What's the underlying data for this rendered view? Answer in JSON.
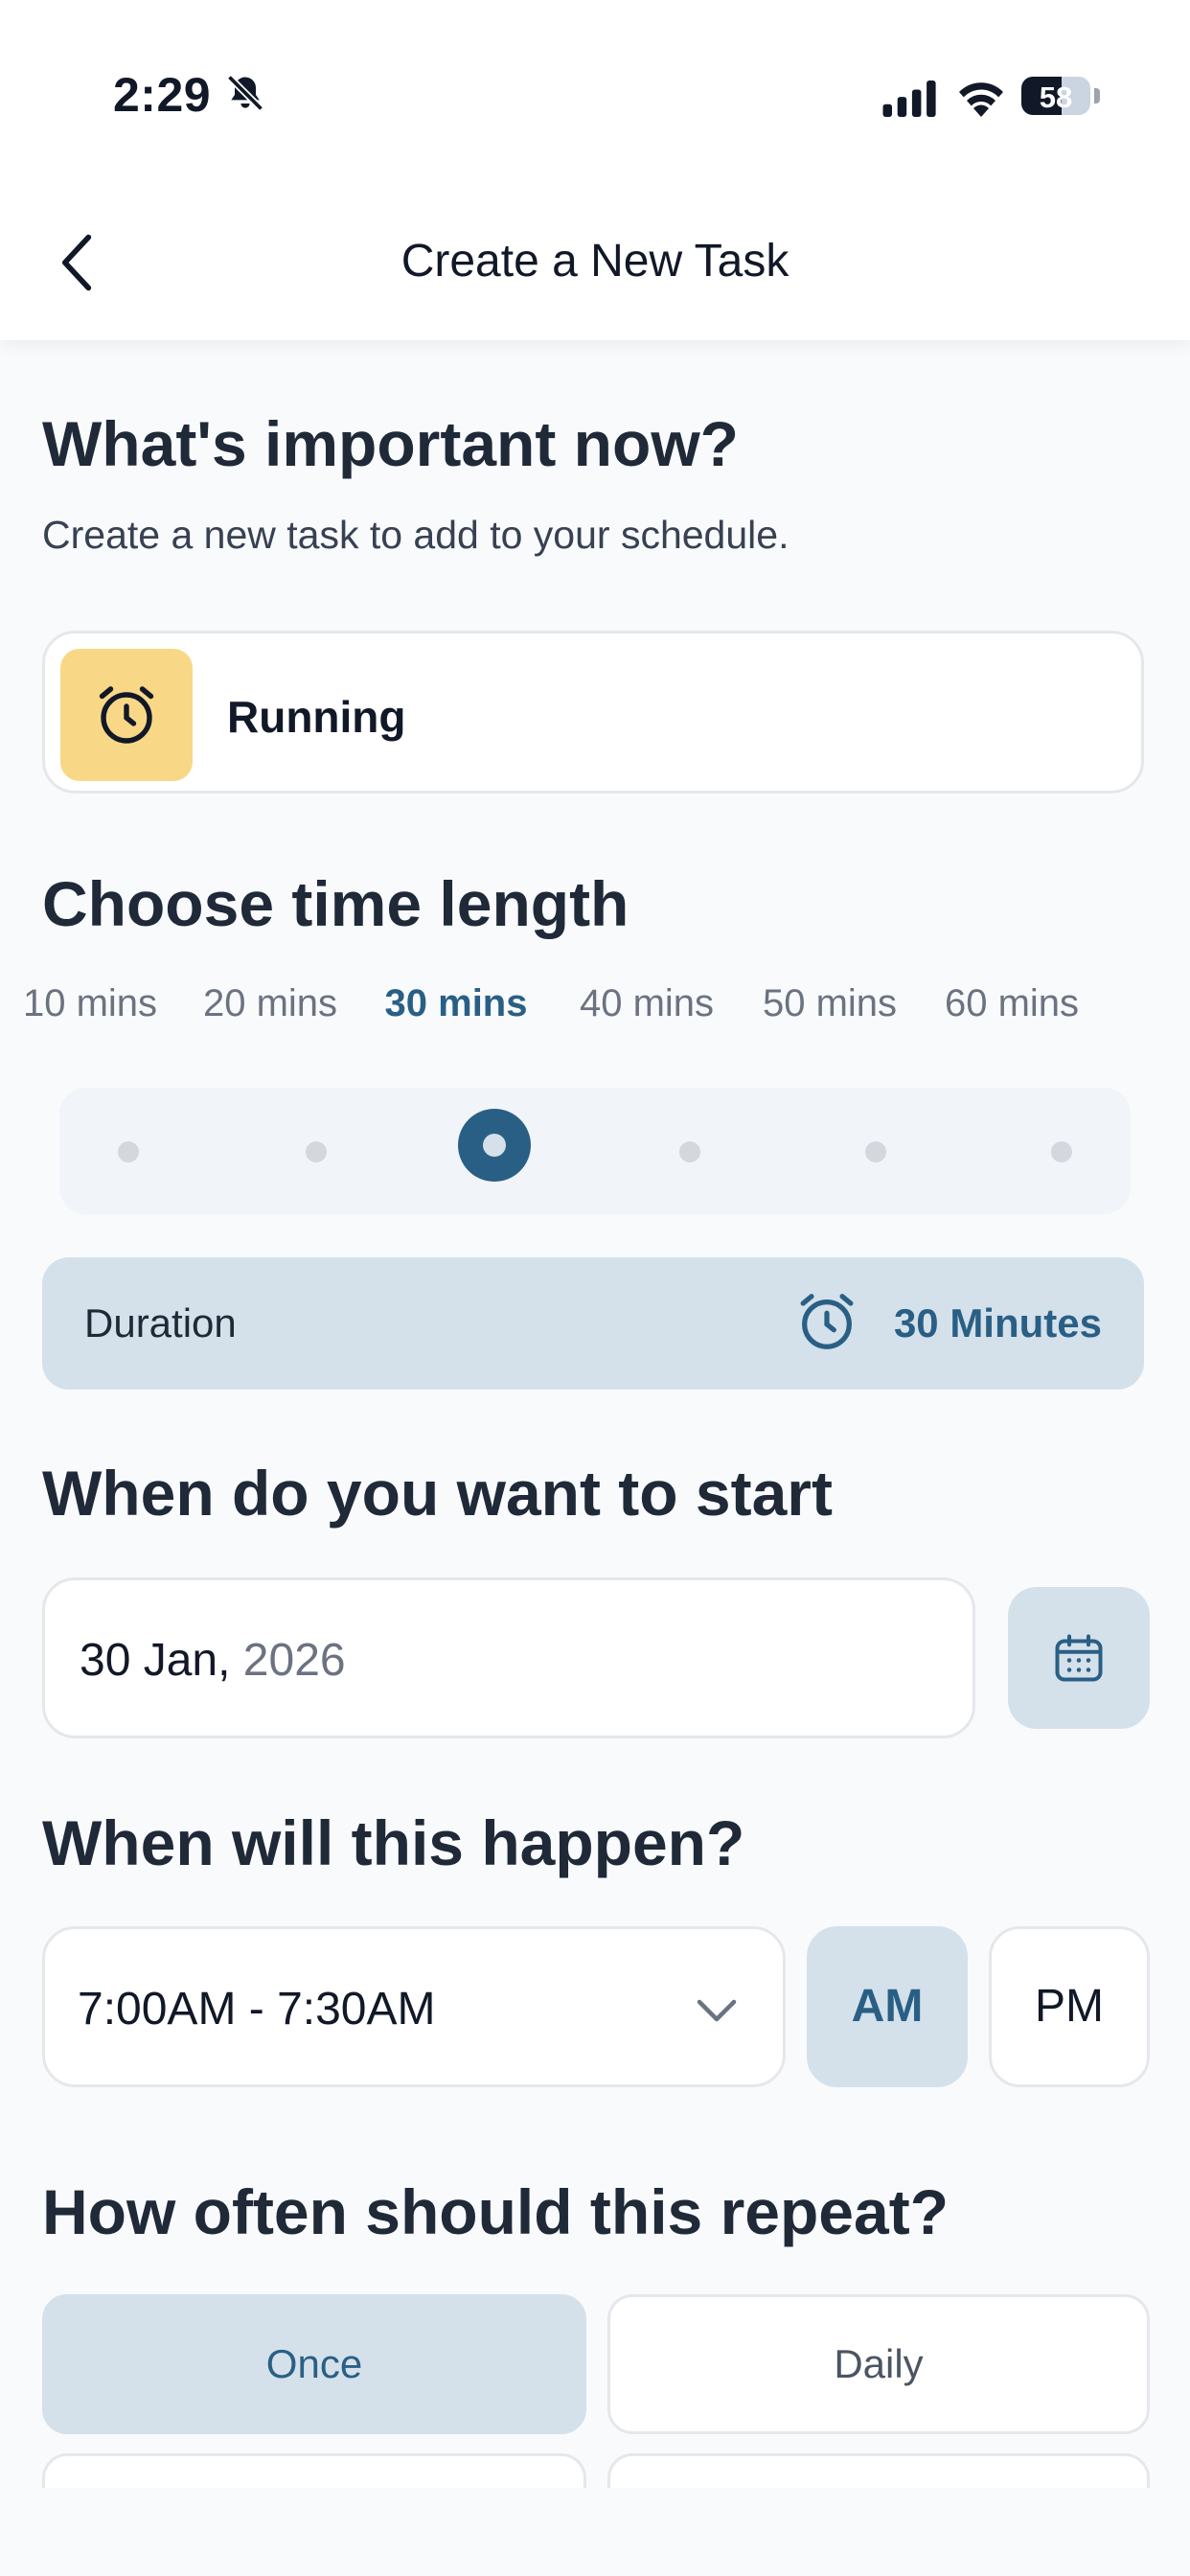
{
  "status_bar": {
    "time": "2:29",
    "battery": "58",
    "battery_level": 0.58
  },
  "header": {
    "title": "Create a New Task"
  },
  "intro": {
    "heading": "What's important now?",
    "subtitle": "Create a new task to add to your schedule."
  },
  "task": {
    "name": "Running",
    "icon": "alarm-clock-icon",
    "icon_bg": "#f8d887"
  },
  "time_length": {
    "heading": "Choose time length",
    "options": [
      "10 mins",
      "20 mins",
      "30 mins",
      "40 mins",
      "50 mins",
      "60 mins"
    ],
    "selected_index": 2
  },
  "duration": {
    "label": "Duration",
    "value": "30 Minutes"
  },
  "start": {
    "heading": "When do you want to start",
    "date_day": "30 Jan,",
    "date_year": "2026"
  },
  "happen": {
    "heading": "When will this happen?",
    "time_range": "7:00AM - 7:30AM",
    "am_label": "AM",
    "pm_label": "PM",
    "selected": "AM"
  },
  "repeat": {
    "heading": "How often should this repeat?",
    "options": [
      "Once",
      "Daily"
    ],
    "selected": "Once"
  },
  "colors": {
    "accent": "#2a5f85",
    "accent_light": "#d4e1ea",
    "background": "#f8fafc"
  }
}
